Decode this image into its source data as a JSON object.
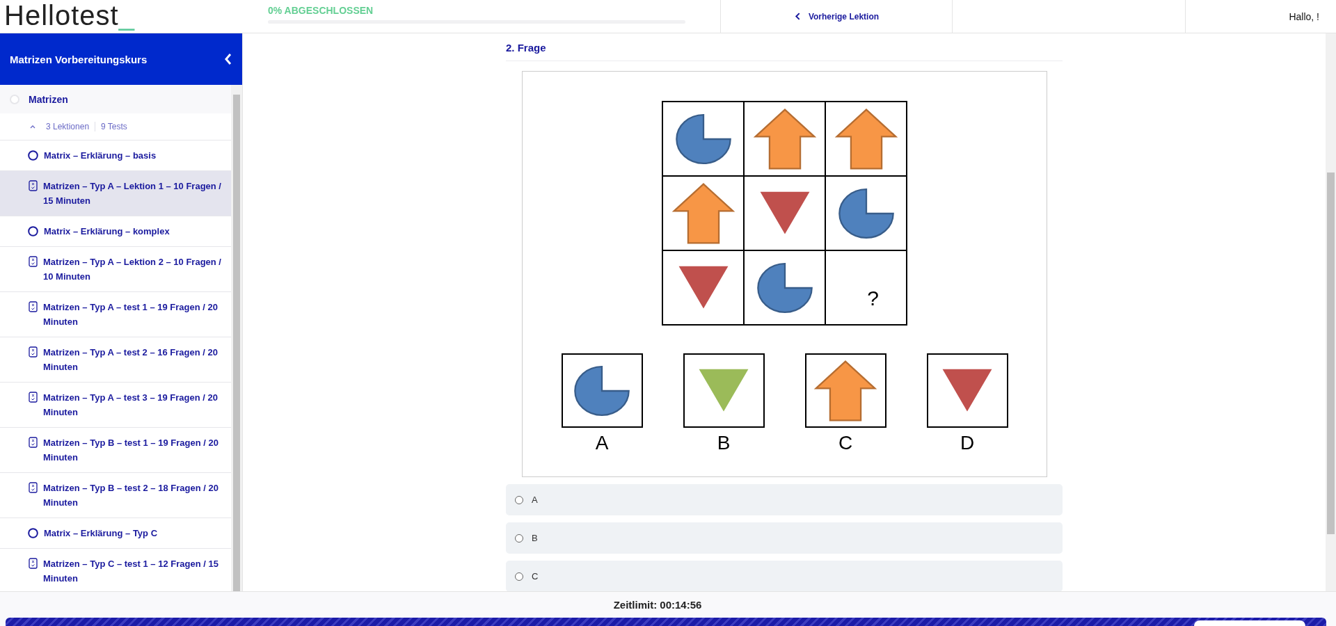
{
  "header": {
    "logo": {
      "name": "Hellotest",
      "mark": "_"
    },
    "progress": {
      "label": "0% ABGESCHLOSSEN",
      "level": 0
    },
    "prev_lesson": "Vorherige Lektion",
    "greeting": "Hallo, !"
  },
  "sidebar": {
    "title": "Matrizen Vorbereitungskurs",
    "section": {
      "title": "Matrizen",
      "done": false,
      "expanded": true,
      "lessons": "3 Lektionen",
      "tests": "9 Tests"
    },
    "items": [
      {
        "kind": "lesson",
        "label": "Matrix – Erklärung – basis",
        "selected": false
      },
      {
        "kind": "test",
        "label": "Matrizen – Typ A – Lektion 1 – 10 Fragen / 15 Minuten",
        "selected": true
      },
      {
        "kind": "lesson",
        "label": "Matrix – Erklärung – komplex",
        "selected": false
      },
      {
        "kind": "test",
        "label": "Matrizen – Typ A – Lektion 2 – 10 Fragen / 10 Minuten",
        "selected": false
      },
      {
        "kind": "test",
        "label": "Matrizen – Typ A – test 1 – 19 Fragen / 20 Minuten",
        "selected": false
      },
      {
        "kind": "test",
        "label": "Matrizen – Typ A – test 2 – 16 Fragen / 20 Minuten",
        "selected": false
      },
      {
        "kind": "test",
        "label": "Matrizen – Typ A – test 3 – 19 Fragen / 20 Minuten",
        "selected": false
      },
      {
        "kind": "test",
        "label": "Matrizen – Typ B – test 1 – 19 Fragen / 20 Minuten",
        "selected": false
      },
      {
        "kind": "test",
        "label": "Matrizen – Typ B – test 2 – 18 Fragen / 20 Minuten",
        "selected": false
      },
      {
        "kind": "lesson",
        "label": "Matrix – Erklärung – Typ C",
        "selected": false
      },
      {
        "kind": "test",
        "label": "Matrizen – Typ C – test 1 – 12 Fragen / 15 Minuten",
        "selected": false
      }
    ]
  },
  "question": {
    "title": "2. Frage",
    "matrix": [
      {
        "kind": "pie",
        "color": "#4f81bd"
      },
      {
        "kind": "arrow",
        "color": "#f79646"
      },
      {
        "kind": "arrow",
        "color": "#f79646"
      },
      {
        "kind": "arrow",
        "color": "#f79646"
      },
      {
        "kind": "triangle",
        "color": "#c0504d"
      },
      {
        "kind": "pie",
        "color": "#4f81bd"
      },
      {
        "kind": "triangle",
        "color": "#c0504d"
      },
      {
        "kind": "pie",
        "color": "#4f81bd"
      },
      {
        "kind": "blank",
        "text": "?"
      }
    ],
    "answers": [
      {
        "label": "A",
        "kind": "pie",
        "color": "#4f81bd"
      },
      {
        "label": "B",
        "kind": "triangle",
        "color": "#9bbb59"
      },
      {
        "label": "C",
        "kind": "arrow",
        "color": "#f79646"
      },
      {
        "label": "D",
        "kind": "triangle",
        "color": "#c0504d"
      }
    ],
    "options": [
      {
        "label": "A",
        "selected": false
      },
      {
        "label": "B",
        "selected": false
      },
      {
        "label": "C",
        "selected": false
      }
    ]
  },
  "footer": {
    "time_limit": "Zeitlimit: 00:14:56"
  }
}
